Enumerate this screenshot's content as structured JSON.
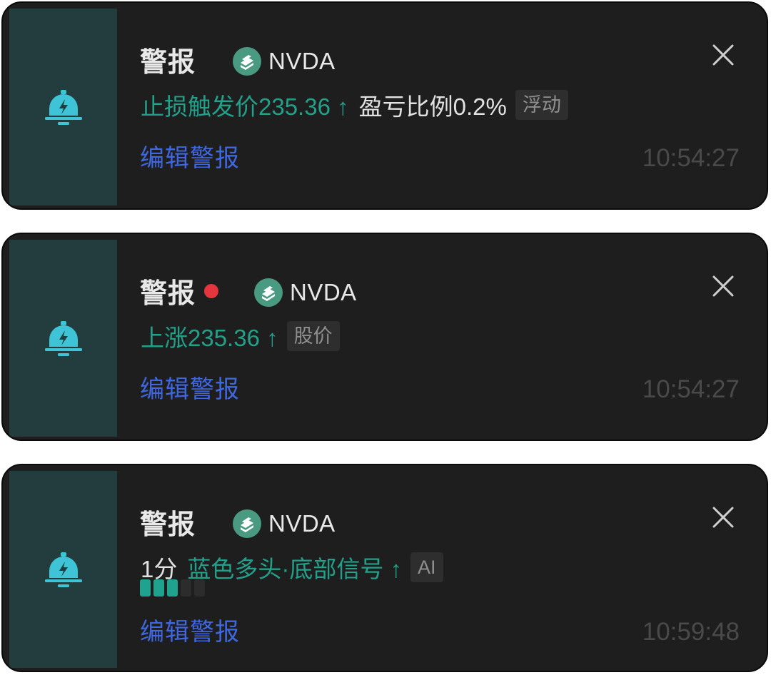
{
  "colors": {
    "card_bg": "#1e1e1e",
    "bell_panel_bg": "#233d3f",
    "bell_icon": "#3ec4d6",
    "accent_green": "#22a08a",
    "link_blue": "#3f67e0",
    "unread_dot": "#e5363d",
    "timestamp": "#4a4a4a"
  },
  "alerts": [
    {
      "icon": "alarm-bell-icon",
      "title": "警报",
      "unread": false,
      "ticker_icon": "nvda-logo-icon",
      "ticker": "NVDA",
      "condition": "止损触发价235.36 ↑",
      "detail": "盈亏比例0.2%",
      "tag": "浮动",
      "edit_label": "编辑警报",
      "time": "10:54:27"
    },
    {
      "icon": "alarm-bell-icon",
      "title": "警报",
      "unread": true,
      "ticker_icon": "nvda-logo-icon",
      "ticker": "NVDA",
      "condition": "上涨235.36 ↑",
      "tag": "股价",
      "edit_label": "编辑警报",
      "time": "10:54:27"
    },
    {
      "icon": "alarm-bell-icon",
      "title": "警报",
      "unread": false,
      "ticker_icon": "nvda-logo-icon",
      "ticker": "NVDA",
      "timeframe": "1分",
      "condition": "蓝色多头·底部信号 ↑",
      "tag": "AI",
      "signal_strength": {
        "filled": 3,
        "total": 5
      },
      "edit_label": "编辑警报",
      "time": "10:59:48"
    }
  ]
}
